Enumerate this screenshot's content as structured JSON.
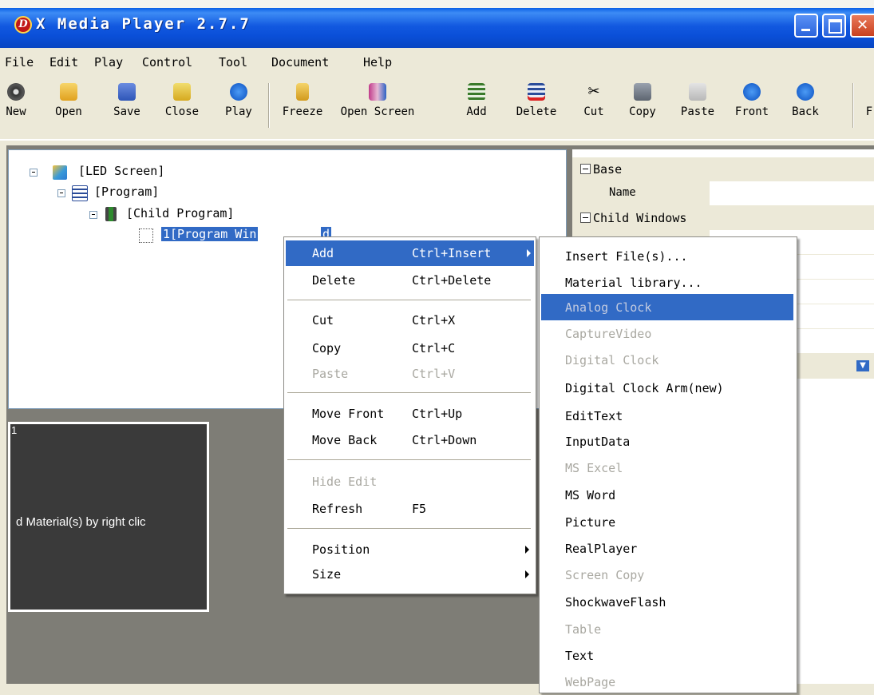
{
  "window": {
    "title": "X Media Player 2.7.7",
    "icon_letter": "D"
  },
  "menubar": {
    "items": [
      "File",
      "Edit",
      "Play",
      "Control",
      "Tool",
      "Document",
      "Help"
    ]
  },
  "toolbar": {
    "buttons": [
      {
        "label": "New",
        "icon": "film-reel-icon"
      },
      {
        "label": "Open",
        "icon": "open-folder-icon"
      },
      {
        "label": "Save",
        "icon": "floppy-disk-icon"
      },
      {
        "label": "Close",
        "icon": "close-document-icon"
      },
      {
        "label": "Play",
        "icon": "play-circle-icon"
      },
      {
        "label": "Freeze",
        "icon": "lock-icon"
      },
      {
        "label": "Open Screen",
        "icon": "screen-door-icon"
      },
      {
        "label": "Add",
        "icon": "add-list-icon"
      },
      {
        "label": "Delete",
        "icon": "delete-list-icon"
      },
      {
        "label": "Cut",
        "icon": "scissors-icon"
      },
      {
        "label": "Copy",
        "icon": "copy-icon"
      },
      {
        "label": "Paste",
        "icon": "paste-icon"
      },
      {
        "label": "Front",
        "icon": "arrow-up-circle-icon"
      },
      {
        "label": "Back",
        "icon": "arrow-down-circle-icon"
      },
      {
        "label": "F",
        "icon": ""
      }
    ]
  },
  "tree": {
    "nodes": [
      {
        "label": "[LED Screen]",
        "icon": "led-screen-icon"
      },
      {
        "label": "[Program]",
        "icon": "program-icon"
      },
      {
        "label": "[Child Program]",
        "icon": "child-program-icon"
      },
      {
        "label": "1[Program Win",
        "label_cut": "d",
        "icon": "program-window-icon"
      }
    ]
  },
  "preview": {
    "index": "1",
    "hint": "d Material(s) by right clic"
  },
  "properties": {
    "categories": [
      {
        "title": "Base",
        "rows": [
          "Name"
        ]
      },
      {
        "title": "Child Windows",
        "rows": []
      }
    ]
  },
  "context_menu": {
    "items": [
      {
        "label": "Add",
        "shortcut": "Ctrl+Insert",
        "submenu": true,
        "highlighted": true
      },
      {
        "label": "Delete",
        "shortcut": "Ctrl+Delete"
      },
      {
        "label": "Cut",
        "shortcut": "Ctrl+X"
      },
      {
        "label": "Copy",
        "shortcut": "Ctrl+C"
      },
      {
        "label": "Paste",
        "shortcut": "Ctrl+V",
        "disabled": true
      },
      {
        "label": "Move Front",
        "shortcut": "Ctrl+Up"
      },
      {
        "label": "Move Back",
        "shortcut": "Ctrl+Down"
      },
      {
        "label": "Hide Edit",
        "shortcut": "",
        "disabled": true
      },
      {
        "label": "Refresh",
        "shortcut": "F5"
      },
      {
        "label": "Position",
        "shortcut": "",
        "submenu": true
      },
      {
        "label": "Size",
        "shortcut": "",
        "submenu": true
      }
    ]
  },
  "add_submenu": {
    "items": [
      {
        "label": "Insert File(s)..."
      },
      {
        "label": "Material library..."
      },
      {
        "label": "Analog Clock",
        "disabled": true,
        "highlighted": true
      },
      {
        "label": "CaptureVideo",
        "disabled": true
      },
      {
        "label": "Digital Clock",
        "disabled": true
      },
      {
        "label": "Digital Clock Arm(new)"
      },
      {
        "label": "EditText"
      },
      {
        "label": "InputData"
      },
      {
        "label": "MS Excel",
        "disabled": true
      },
      {
        "label": "MS Word"
      },
      {
        "label": "Picture"
      },
      {
        "label": "RealPlayer"
      },
      {
        "label": "Screen Copy",
        "disabled": true
      },
      {
        "label": "ShockwaveFlash"
      },
      {
        "label": "Table",
        "disabled": true
      },
      {
        "label": "Text"
      },
      {
        "label": "WebPage",
        "disabled": true
      }
    ]
  },
  "colors": {
    "titlebar": "#0a4fd8",
    "highlight": "#316ac5",
    "disabled_text": "#a9a8a1",
    "window_face": "#ece9d8"
  }
}
